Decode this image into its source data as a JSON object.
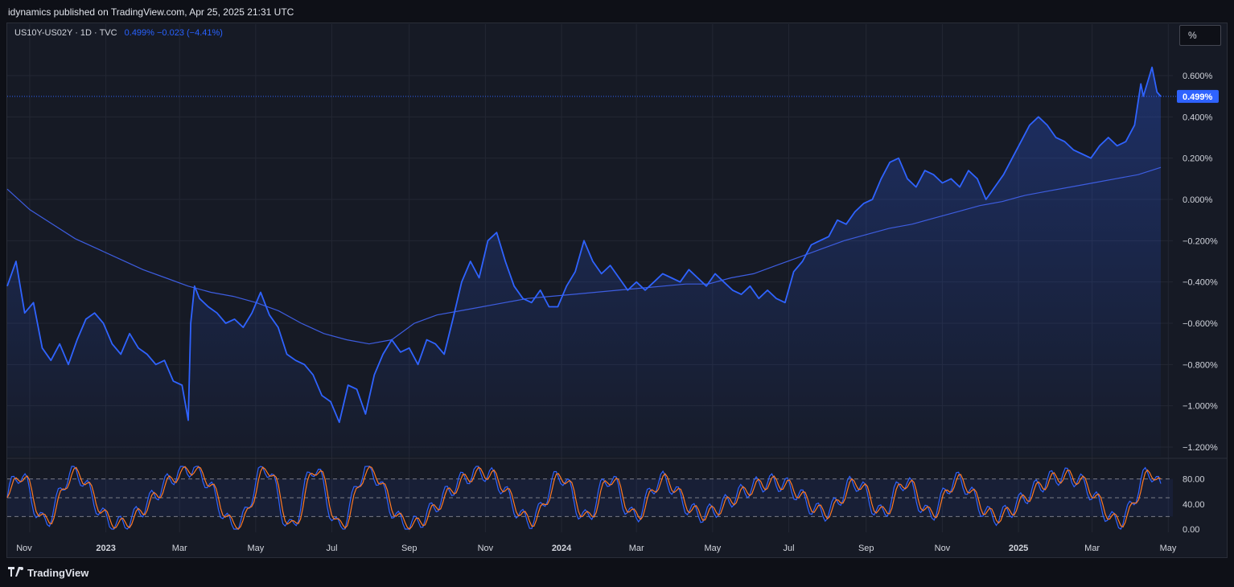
{
  "header": {
    "publisher": "idynamics published on TradingView.com, Apr 25, 2025 21:31 UTC"
  },
  "legend": {
    "symbol": "US10Y-US02Y · 1D · TVC",
    "values": "0.499%  −0.023 (−4.41%)"
  },
  "scale_button": "%",
  "footer": {
    "brand": "TradingView"
  },
  "colors": {
    "price_line": "#2f63ff",
    "ma_line": "#3d5de0",
    "stoch_k": "#2f63ff",
    "stoch_d": "#ff7a24",
    "background": "#161a25",
    "grid": "#232733"
  },
  "chart_data": [
    {
      "type": "area",
      "series_symbol": "US10Y-US02Y",
      "timeframe": "1D",
      "last_value_label": "0.499%",
      "y_ticks": [
        "0.600%",
        "0.400%",
        "0.200%",
        "0.000%",
        "−0.200%",
        "−0.400%",
        "−0.600%",
        "−0.800%",
        "−1.000%",
        "−1.200%"
      ],
      "ylim": [
        -1.25,
        0.72
      ],
      "x_ticks": [
        "Nov",
        "2023",
        "Mar",
        "May",
        "Jul",
        "Sep",
        "Nov",
        "2024",
        "Mar",
        "May",
        "Jul",
        "Sep",
        "Nov",
        "2025",
        "Mar",
        "May"
      ],
      "series": [
        {
          "x": [
            "2022-10-14",
            "2022-10-21",
            "2022-10-28",
            "2022-11-04",
            "2022-11-11",
            "2022-11-18",
            "2022-11-25",
            "2022-12-02",
            "2022-12-09",
            "2022-12-16",
            "2022-12-23",
            "2022-12-30",
            "2023-01-06",
            "2023-01-13",
            "2023-01-20",
            "2023-01-27",
            "2023-02-03",
            "2023-02-10",
            "2023-02-17",
            "2023-02-24",
            "2023-03-03",
            "2023-03-08",
            "2023-03-10",
            "2023-03-13",
            "2023-03-17",
            "2023-03-24",
            "2023-03-31",
            "2023-04-07",
            "2023-04-14",
            "2023-04-21",
            "2023-04-28",
            "2023-05-05",
            "2023-05-12",
            "2023-05-19",
            "2023-05-26",
            "2023-06-02",
            "2023-06-09",
            "2023-06-16",
            "2023-06-23",
            "2023-06-30",
            "2023-07-07",
            "2023-07-14",
            "2023-07-21",
            "2023-07-28",
            "2023-08-04",
            "2023-08-11",
            "2023-08-18",
            "2023-08-25",
            "2023-09-01",
            "2023-09-08",
            "2023-09-15",
            "2023-09-22",
            "2023-09-29",
            "2023-10-06",
            "2023-10-13",
            "2023-10-20",
            "2023-10-27",
            "2023-11-03",
            "2023-11-10",
            "2023-11-17",
            "2023-11-24",
            "2023-12-01",
            "2023-12-08",
            "2023-12-15",
            "2023-12-22",
            "2023-12-29",
            "2024-01-05",
            "2024-01-12",
            "2024-01-19",
            "2024-01-26",
            "2024-02-02",
            "2024-02-09",
            "2024-02-16",
            "2024-02-23",
            "2024-03-01",
            "2024-03-08",
            "2024-03-15",
            "2024-03-22",
            "2024-03-29",
            "2024-04-05",
            "2024-04-12",
            "2024-04-19",
            "2024-04-26",
            "2024-05-03",
            "2024-05-10",
            "2024-05-17",
            "2024-05-24",
            "2024-05-31",
            "2024-06-07",
            "2024-06-14",
            "2024-06-21",
            "2024-06-28",
            "2024-07-05",
            "2024-07-12",
            "2024-07-19",
            "2024-07-26",
            "2024-08-02",
            "2024-08-09",
            "2024-08-16",
            "2024-08-23",
            "2024-08-30",
            "2024-09-06",
            "2024-09-13",
            "2024-09-20",
            "2024-09-27",
            "2024-10-04",
            "2024-10-11",
            "2024-10-18",
            "2024-10-25",
            "2024-11-01",
            "2024-11-08",
            "2024-11-15",
            "2024-11-22",
            "2024-11-29",
            "2024-12-06",
            "2024-12-13",
            "2024-12-20",
            "2024-12-27",
            "2025-01-03",
            "2025-01-10",
            "2025-01-17",
            "2025-01-24",
            "2025-01-31",
            "2025-02-07",
            "2025-02-14",
            "2025-02-21",
            "2025-02-28",
            "2025-03-07",
            "2025-03-14",
            "2025-03-21",
            "2025-03-28",
            "2025-04-04",
            "2025-04-09",
            "2025-04-11",
            "2025-04-18",
            "2025-04-22",
            "2025-04-25"
          ],
          "values": [
            -0.42,
            -0.3,
            -0.55,
            -0.5,
            -0.72,
            -0.78,
            -0.7,
            -0.8,
            -0.68,
            -0.58,
            -0.55,
            -0.6,
            -0.7,
            -0.75,
            -0.65,
            -0.72,
            -0.75,
            -0.8,
            -0.78,
            -0.88,
            -0.9,
            -1.07,
            -0.6,
            -0.42,
            -0.48,
            -0.52,
            -0.55,
            -0.6,
            -0.58,
            -0.62,
            -0.55,
            -0.45,
            -0.56,
            -0.62,
            -0.75,
            -0.78,
            -0.8,
            -0.85,
            -0.95,
            -0.98,
            -1.08,
            -0.9,
            -0.92,
            -1.04,
            -0.85,
            -0.75,
            -0.68,
            -0.74,
            -0.72,
            -0.8,
            -0.68,
            -0.7,
            -0.75,
            -0.58,
            -0.4,
            -0.3,
            -0.38,
            -0.2,
            -0.16,
            -0.3,
            -0.42,
            -0.48,
            -0.5,
            -0.44,
            -0.52,
            -0.52,
            -0.42,
            -0.35,
            -0.2,
            -0.3,
            -0.36,
            -0.32,
            -0.38,
            -0.44,
            -0.4,
            -0.44,
            -0.4,
            -0.36,
            -0.38,
            -0.4,
            -0.34,
            -0.38,
            -0.42,
            -0.36,
            -0.4,
            -0.44,
            -0.46,
            -0.42,
            -0.48,
            -0.44,
            -0.48,
            -0.5,
            -0.35,
            -0.3,
            -0.22,
            -0.2,
            -0.18,
            -0.1,
            -0.12,
            -0.06,
            -0.02,
            0.0,
            0.1,
            0.18,
            0.2,
            0.1,
            0.06,
            0.14,
            0.12,
            0.08,
            0.1,
            0.06,
            0.14,
            0.1,
            0.0,
            0.06,
            0.12,
            0.2,
            0.28,
            0.36,
            0.4,
            0.36,
            0.3,
            0.28,
            0.24,
            0.22,
            0.2,
            0.26,
            0.3,
            0.26,
            0.28,
            0.36,
            0.56,
            0.5,
            0.64,
            0.52,
            0.499
          ]
        }
      ],
      "moving_average": {
        "values": [
          0.05,
          -0.05,
          -0.12,
          -0.19,
          -0.24,
          -0.29,
          -0.34,
          -0.38,
          -0.42,
          -0.45,
          -0.47,
          -0.5,
          -0.54,
          -0.6,
          -0.65,
          -0.68,
          -0.7,
          -0.68,
          -0.6,
          -0.56,
          -0.54,
          -0.52,
          -0.5,
          -0.48,
          -0.47,
          -0.46,
          -0.45,
          -0.44,
          -0.43,
          -0.42,
          -0.41,
          -0.41,
          -0.38,
          -0.36,
          -0.32,
          -0.28,
          -0.24,
          -0.2,
          -0.17,
          -0.14,
          -0.12,
          -0.09,
          -0.06,
          -0.03,
          -0.01,
          0.02,
          0.04,
          0.06,
          0.08,
          0.1,
          0.12,
          0.155
        ]
      },
      "stochastic": {
        "levels": [
          80,
          50,
          20
        ],
        "y_ticks": [
          "80.00",
          "40.00",
          "0.00"
        ],
        "ylim": [
          0,
          100
        ]
      }
    }
  ]
}
